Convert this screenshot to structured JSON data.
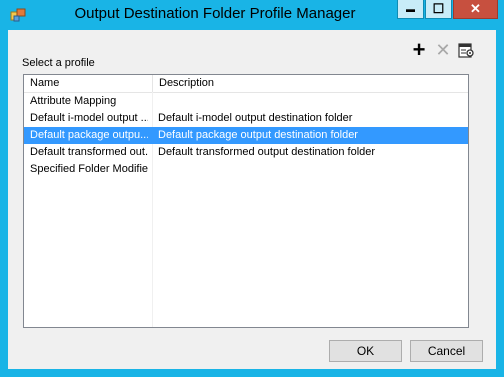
{
  "window": {
    "title": "Output Destination Folder Profile Manager",
    "controls": {
      "minimize": "▬",
      "maximize": "☐",
      "close": "✕"
    },
    "colors": {
      "frame": "#19b4e6",
      "close": "#c7503f",
      "selection": "#3399ff"
    }
  },
  "toolbar": {
    "add_icon": "plus-icon",
    "add_glyph": "+",
    "delete_icon": "x-icon",
    "delete_glyph": "✕",
    "properties_icon": "properties-icon"
  },
  "main": {
    "select_label": "Select a  profile",
    "columns": [
      "Name",
      "Description"
    ],
    "rows": [
      {
        "name": "Attribute Mapping",
        "description": ""
      },
      {
        "name": "Default i-model output ...",
        "description": "Default i-model output destination folder"
      },
      {
        "name": "Default package outpu...",
        "description": "Default package output destination folder",
        "selected": true
      },
      {
        "name": "Default transformed out...",
        "description": "Default transformed output destination folder"
      },
      {
        "name": "Specified Folder Modified",
        "description": ""
      }
    ]
  },
  "buttons": {
    "ok": "OK",
    "cancel": "Cancel"
  }
}
